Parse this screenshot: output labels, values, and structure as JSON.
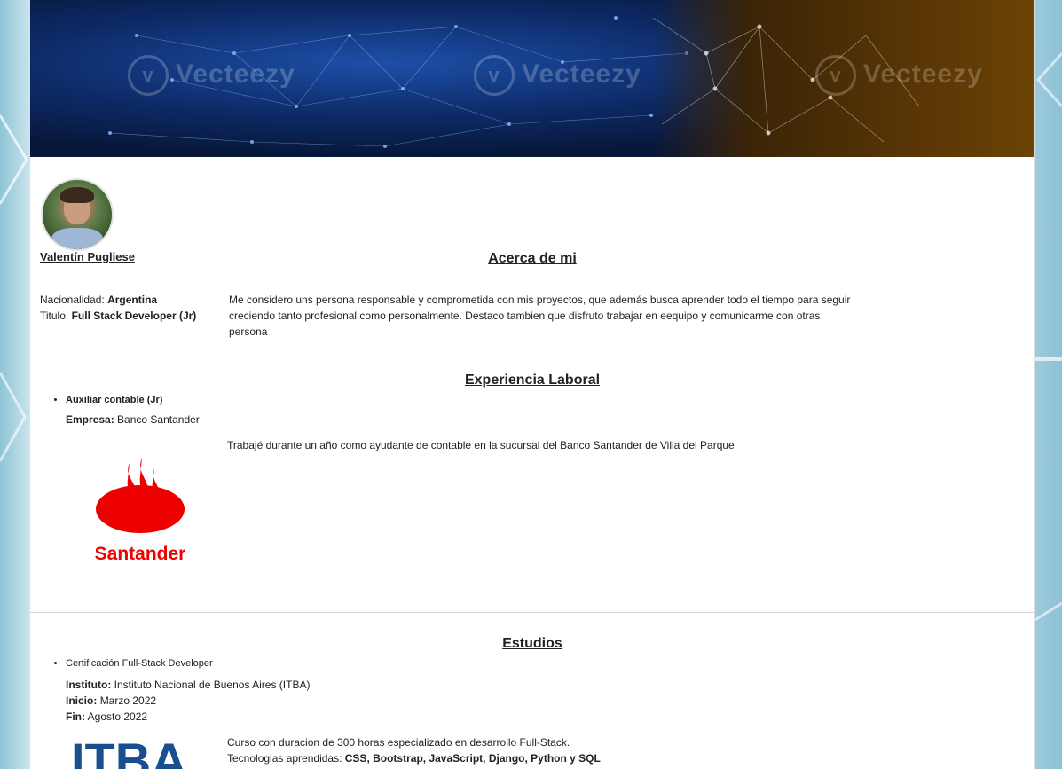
{
  "banner": {
    "watermark_text": "Vecteezy",
    "colors": {
      "left": "#0d2a66",
      "right": "#5a3605"
    }
  },
  "profile": {
    "name": "Valentín Pugliese",
    "nationality_label": "Nacionalidad:",
    "nationality_value": "Argentina",
    "title_label": "Titulo:",
    "title_value": "Full Stack Developer (Jr)"
  },
  "about": {
    "heading": "Acerca de mi",
    "text": "Me considero uns persona responsable y comprometida con mis proyectos, que además busca aprender todo el tiempo para seguir creciendo tanto profesional como personalmente. Destaco tambien que disfruto trabajar en eequipo y comunicarme con otras persona"
  },
  "experience": {
    "heading": "Experiencia Laboral",
    "job_title": "Auxiliar contable (Jr)",
    "company_label": "Empresa:",
    "company_value": "Banco Santander",
    "description": "Trabajé durante un año como ayudante de contable en la sucursal del Banco Santander de Villa del Parque",
    "logo_text": "Santander",
    "logo_color": "#ec0000"
  },
  "studies": {
    "heading": "Estudios",
    "course_title": "Certificación Full-Stack Developer",
    "institute_label": "Instituto:",
    "institute_value": "Instituto Nacional de Buenos Aires (ITBA)",
    "start_label": "Inicio:",
    "start_value": "Marzo 2022",
    "end_label": "Fin:",
    "end_value": "Agosto 2022",
    "description": "Curso con duracion de 300 horas especializado en desarrollo Full-Stack.",
    "tech_label": "Tecnologias aprendidas:",
    "tech_value": "CSS, Bootstrap, JavaScript, Django, Python y SQL",
    "logo_text": "ITBA",
    "logo_color": "#1a4f8f"
  }
}
